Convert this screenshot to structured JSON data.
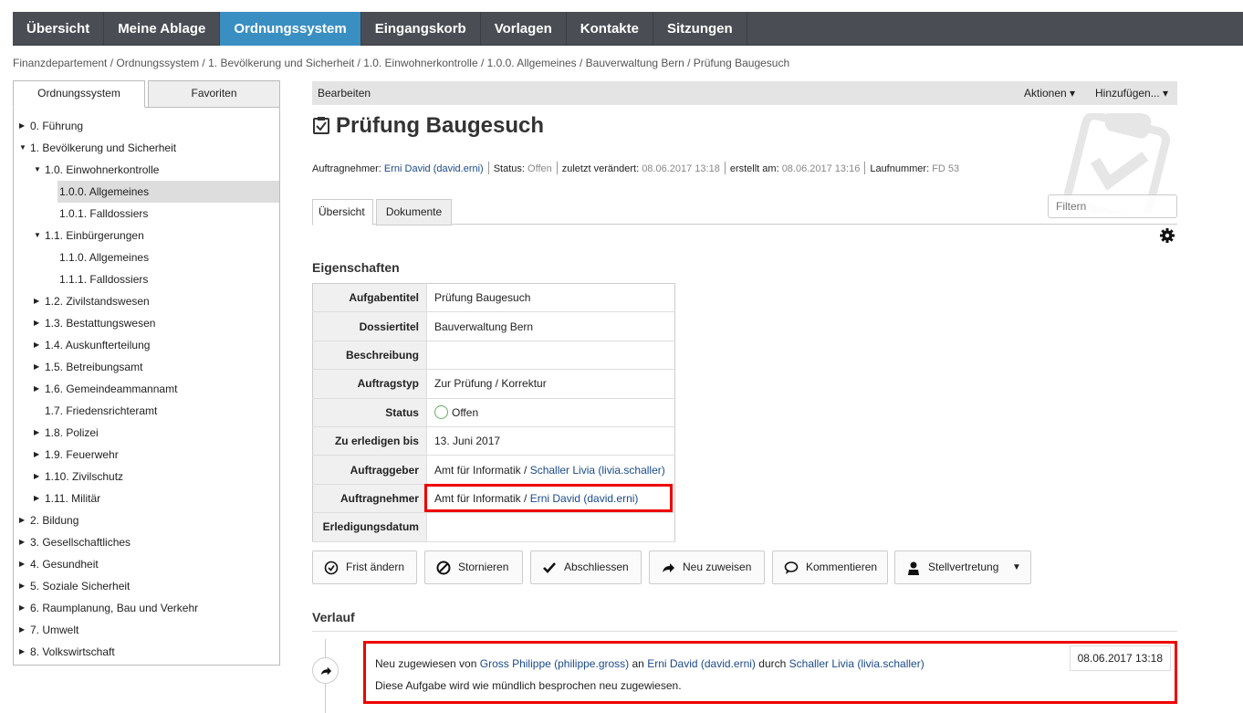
{
  "nav": {
    "items": [
      "Übersicht",
      "Meine Ablage",
      "Ordnungssystem",
      "Eingangskorb",
      "Vorlagen",
      "Kontakte",
      "Sitzungen"
    ],
    "active": "Ordnungssystem"
  },
  "breadcrumb": "Finanzdepartement / Ordnungssystem / 1. Bevölkerung und Sicherheit / 1.0. Einwohnerkontrolle / 1.0.0. Allgemeines / Bauverwaltung Bern / Prüfung Baugesuch",
  "sidebar": {
    "tabs": [
      "Ordnungssystem",
      "Favoriten"
    ],
    "tree": [
      {
        "label": "0. Führung",
        "expanded": false
      },
      {
        "label": "1. Bevölkerung und Sicherheit",
        "expanded": true
      },
      {
        "label": "1.0. Einwohnerkontrolle",
        "expanded": true
      },
      {
        "label": "1.0.0. Allgemeines",
        "selected": true
      },
      {
        "label": "1.0.1. Falldossiers"
      },
      {
        "label": "1.1. Einbürgerungen",
        "expanded": true
      },
      {
        "label": "1.1.0. Allgemeines"
      },
      {
        "label": "1.1.1. Falldossiers"
      },
      {
        "label": "1.2. Zivilstandswesen",
        "expanded": false
      },
      {
        "label": "1.3. Bestattungswesen",
        "expanded": false
      },
      {
        "label": "1.4. Auskunfterteilung",
        "expanded": false
      },
      {
        "label": "1.5. Betreibungsamt",
        "expanded": false
      },
      {
        "label": "1.6. Gemeindeammannamt",
        "expanded": false
      },
      {
        "label": "1.7. Friedensrichteramt"
      },
      {
        "label": "1.8. Polizei",
        "expanded": false
      },
      {
        "label": "1.9. Feuerwehr",
        "expanded": false
      },
      {
        "label": "1.10. Zivilschutz",
        "expanded": false
      },
      {
        "label": "1.11. Militär",
        "expanded": false
      },
      {
        "label": "2. Bildung",
        "expanded": false
      },
      {
        "label": "3. Gesellschaftliches",
        "expanded": false
      },
      {
        "label": "4. Gesundheit",
        "expanded": false
      },
      {
        "label": "5. Soziale Sicherheit",
        "expanded": false
      },
      {
        "label": "6. Raumplanung, Bau und Verkehr",
        "expanded": false
      },
      {
        "label": "7. Umwelt",
        "expanded": false
      },
      {
        "label": "8. Volkswirtschaft",
        "expanded": false
      }
    ]
  },
  "toolbar": {
    "edit": "Bearbeiten",
    "actions": "Aktionen ▾",
    "add": "Hinzufügen... ▾"
  },
  "task": {
    "title": "Prüfung Baugesuch",
    "meta": {
      "assignee_label": "Auftragnehmer:",
      "assignee": "Erni David (david.erni)",
      "status_label": "Status:",
      "status": "Offen",
      "modified_label": "zuletzt verändert:",
      "modified": "08.06.2017 13:18",
      "created_label": "erstellt am:",
      "created": "08.06.2017 13:16",
      "number_label": "Laufnummer:",
      "number": "FD 53"
    }
  },
  "tabs": [
    "Übersicht",
    "Dokumente"
  ],
  "filter_placeholder": "Filtern",
  "properties": {
    "heading": "Eigenschaften",
    "rows": [
      {
        "key": "Aufgabentitel",
        "value": "Prüfung Baugesuch"
      },
      {
        "key": "Dossiertitel",
        "value": "Bauverwaltung Bern"
      },
      {
        "key": "Beschreibung",
        "value": ""
      },
      {
        "key": "Auftragstyp",
        "value": "Zur Prüfung / Korrektur"
      },
      {
        "key": "Status",
        "value": "Offen"
      },
      {
        "key": "Zu erledigen bis",
        "value": "13. Juni 2017"
      },
      {
        "key": "Auftraggeber",
        "value_prefix": "Amt für Informatik / ",
        "value_link": "Schaller Livia (livia.schaller)"
      },
      {
        "key": "Auftragnehmer",
        "value_prefix": "Amt für Informatik / ",
        "value_link": "Erni David (david.erni)"
      },
      {
        "key": "Erledigungsdatum",
        "value": ""
      }
    ]
  },
  "buttons": [
    "Frist ändern",
    "Stornieren",
    "Abschliessen",
    "Neu zuweisen",
    "Kommentieren",
    "Stellvertretung"
  ],
  "history": {
    "heading": "Verlauf",
    "entry": {
      "prefix": "Neu zugewiesen von",
      "from": "Gross Philippe (philippe.gross)",
      "to_word": "an",
      "to": "Erni David (david.erni)",
      "by_word": "durch",
      "by": "Schaller Livia (livia.schaller)",
      "comment": "Diese Aufgabe wird wie mündlich besprochen neu zugewiesen.",
      "date": "08.06.2017 13:18"
    }
  }
}
